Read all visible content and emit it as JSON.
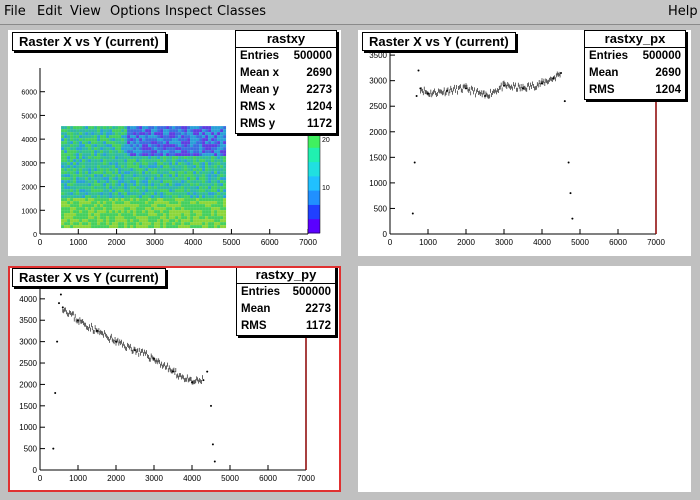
{
  "menu": {
    "file": "File",
    "edit": "Edit",
    "view": "View",
    "options": "Options",
    "inspect": "Inspect",
    "classes": "Classes",
    "help": "Help"
  },
  "colors": {
    "background": "#c0c0c0",
    "active_pad": "#e03030",
    "axis": "#000000",
    "hist_line": "#8b0000"
  },
  "pads": [
    {
      "title": "Raster X vs Y (current)",
      "stats": {
        "name": "rastxy",
        "rows": [
          {
            "label": "Entries",
            "value": "500000"
          },
          {
            "label": "Mean x",
            "value": "2690"
          },
          {
            "label": "Mean y",
            "value": "2273"
          },
          {
            "label": "RMS x",
            "value": "1204"
          },
          {
            "label": "RMS y",
            "value": "1172"
          }
        ]
      },
      "colz_ticks": [
        "10",
        "20"
      ]
    },
    {
      "title": "Raster X vs Y (current)",
      "stats": {
        "name": "rastxy_px",
        "rows": [
          {
            "label": "Entries",
            "value": "500000"
          },
          {
            "label": "Mean",
            "value": "2690"
          },
          {
            "label": "RMS",
            "value": "1204"
          }
        ]
      }
    },
    {
      "title": "Raster X vs Y (current)",
      "stats": {
        "name": "rastxy_py",
        "rows": [
          {
            "label": "Entries",
            "value": "500000"
          },
          {
            "label": "Mean",
            "value": "2273"
          },
          {
            "label": "RMS",
            "value": "1172"
          }
        ]
      }
    }
  ],
  "chart_data": [
    {
      "type": "heatmap",
      "title": "Raster X vs Y (current)",
      "xlim": [
        0,
        7000
      ],
      "ylim": [
        0,
        7000
      ],
      "xticks": [
        "0",
        "1000",
        "2000",
        "3000",
        "4000",
        "5000",
        "6000",
        "7000"
      ],
      "yticks": [
        "0",
        "1000",
        "2000",
        "3000",
        "4000",
        "5000",
        "6000"
      ],
      "filled_region": {
        "x": [
          550,
          4800
        ],
        "y": [
          350,
          4550
        ]
      },
      "zticks": [
        "10",
        "20"
      ]
    },
    {
      "type": "scatter",
      "title": "Raster X vs Y (current)",
      "xlim": [
        0,
        7000
      ],
      "ylim": [
        0,
        3600
      ],
      "xticks": [
        "0",
        "1000",
        "2000",
        "3000",
        "4000",
        "5000",
        "6000",
        "7000"
      ],
      "yticks": [
        "0",
        "500",
        "1000",
        "1500",
        "2000",
        "2500",
        "3000",
        "3500"
      ],
      "x": [
        600,
        650,
        700,
        750,
        800,
        1000,
        1500,
        2000,
        2500,
        3000,
        3500,
        4000,
        4300,
        4500,
        4600,
        4700,
        4750,
        4800
      ],
      "y": [
        400,
        1400,
        2700,
        3200,
        2850,
        2750,
        2800,
        2850,
        2700,
        2900,
        2850,
        2950,
        3050,
        3150,
        2600,
        1400,
        800,
        300
      ]
    },
    {
      "type": "scatter",
      "title": "Raster X vs Y (current)",
      "xlim": [
        0,
        7000
      ],
      "ylim": [
        0,
        4300
      ],
      "xticks": [
        "0",
        "1000",
        "2000",
        "3000",
        "4000",
        "5000",
        "6000",
        "7000"
      ],
      "yticks": [
        "0",
        "500",
        "1000",
        "1500",
        "2000",
        "2500",
        "3000",
        "3500",
        "4000"
      ],
      "x": [
        350,
        400,
        450,
        500,
        550,
        600,
        1000,
        1500,
        2000,
        2500,
        3000,
        3500,
        4000,
        4300,
        4400,
        4500,
        4550,
        4600
      ],
      "y": [
        500,
        1800,
        3000,
        3900,
        4100,
        3800,
        3500,
        3250,
        3000,
        2800,
        2600,
        2300,
        2050,
        2100,
        2300,
        1500,
        600,
        200
      ]
    }
  ]
}
